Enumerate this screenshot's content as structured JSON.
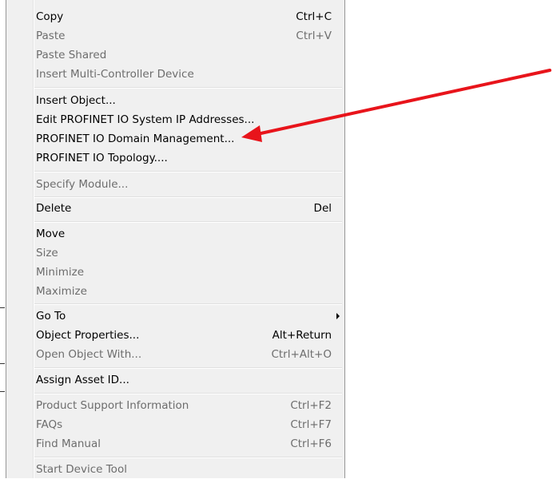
{
  "menu": {
    "items": [
      {
        "label": "Copy",
        "shortcut": "Ctrl+C",
        "disabled": false
      },
      {
        "label": "Paste",
        "shortcut": "Ctrl+V",
        "disabled": true
      },
      {
        "label": "Paste Shared",
        "shortcut": "",
        "disabled": true
      },
      {
        "label": "Insert Multi-Controller Device",
        "shortcut": "",
        "disabled": true
      },
      {
        "label": "Insert Object...",
        "shortcut": "",
        "disabled": false
      },
      {
        "label": "Edit PROFINET IO System IP Addresses...",
        "shortcut": "",
        "disabled": false
      },
      {
        "label": "PROFINET IO Domain Management...",
        "shortcut": "",
        "disabled": false
      },
      {
        "label": "PROFINET IO Topology....",
        "shortcut": "",
        "disabled": false
      },
      {
        "label": "Specify Module...",
        "shortcut": "",
        "disabled": true
      },
      {
        "label": "Delete",
        "shortcut": "Del",
        "disabled": false
      },
      {
        "label": "Move",
        "shortcut": "",
        "disabled": false
      },
      {
        "label": "Size",
        "shortcut": "",
        "disabled": true
      },
      {
        "label": "Minimize",
        "shortcut": "",
        "disabled": true
      },
      {
        "label": "Maximize",
        "shortcut": "",
        "disabled": true
      },
      {
        "label": "Go To",
        "shortcut": "",
        "disabled": false,
        "submenu": true
      },
      {
        "label": "Object Properties...",
        "shortcut": "Alt+Return",
        "disabled": false
      },
      {
        "label": "Open Object With...",
        "shortcut": "Ctrl+Alt+O",
        "disabled": true
      },
      {
        "label": "Assign Asset ID...",
        "shortcut": "",
        "disabled": false
      },
      {
        "label": "Product Support Information",
        "shortcut": "Ctrl+F2",
        "disabled": true
      },
      {
        "label": "FAQs",
        "shortcut": "Ctrl+F7",
        "disabled": true
      },
      {
        "label": "Find Manual",
        "shortcut": "Ctrl+F6",
        "disabled": true
      },
      {
        "label": "Start Device Tool",
        "shortcut": "",
        "disabled": true
      }
    ]
  },
  "annotation": {
    "arrow_color": "#e8141b",
    "points_to": "PROFINET IO Domain Management..."
  },
  "colors": {
    "menu_bg": "#f0f0f0",
    "disabled_text": "#6d6d6d",
    "enabled_text": "#000000"
  }
}
